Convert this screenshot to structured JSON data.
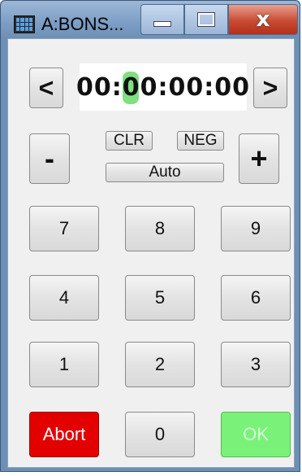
{
  "window": {
    "title": "A:BONS...",
    "minimize_icon": "minimize-icon",
    "maximize_icon": "maximize-icon",
    "close_icon": "close-icon",
    "close_label": "x"
  },
  "display": {
    "timecode": "00:00:00:00",
    "prev_label": "<",
    "next_label": ">"
  },
  "controls": {
    "minus_label": "-",
    "plus_label": "+",
    "clr_label": "CLR",
    "neg_label": "NEG",
    "auto_label": "Auto"
  },
  "keypad": {
    "k7": "7",
    "k8": "8",
    "k9": "9",
    "k4": "4",
    "k5": "5",
    "k6": "6",
    "k1": "1",
    "k2": "2",
    "k3": "3",
    "abort": "Abort",
    "k0": "0",
    "ok": "OK"
  },
  "colors": {
    "abort_bg": "#e30000",
    "ok_bg": "#7af27a",
    "cursor": "#7fe07f"
  }
}
